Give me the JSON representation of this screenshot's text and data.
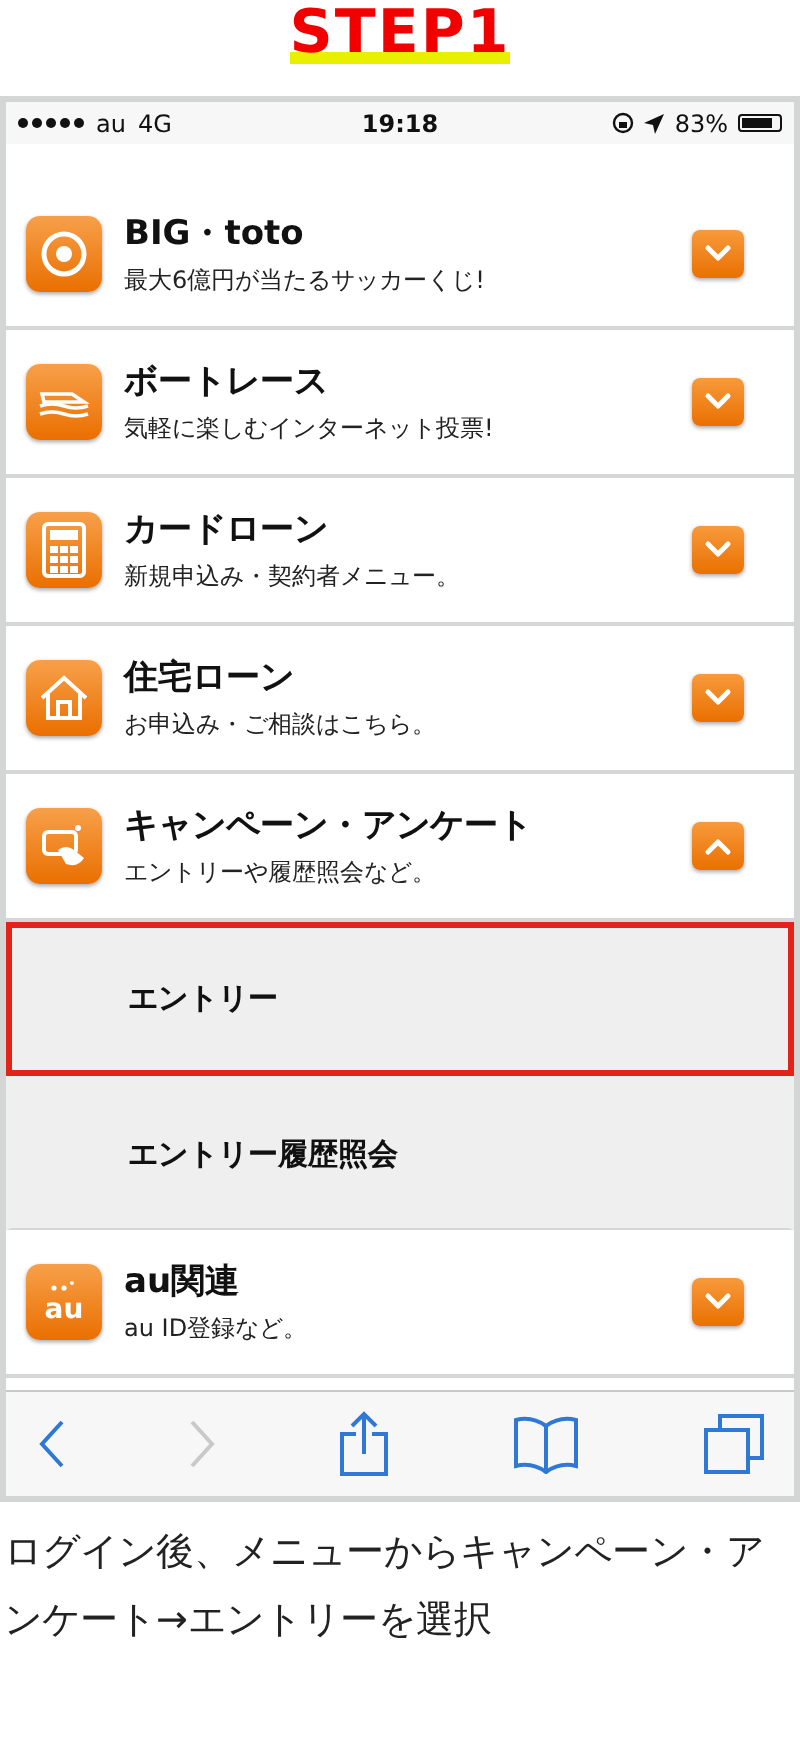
{
  "heading": "STEP1",
  "status_bar": {
    "carrier": "au",
    "network": "4G",
    "time": "19:18",
    "battery": "83%"
  },
  "menu": [
    {
      "kind": "item",
      "title": "BIG・toto",
      "subtitle": "最大6億円が当たるサッカーくじ!",
      "expanded": false
    },
    {
      "kind": "item",
      "title": "ボートレース",
      "subtitle": "気軽に楽しむインターネット投票!",
      "expanded": false
    },
    {
      "kind": "item",
      "title": "カードローン",
      "subtitle": "新規申込み・契約者メニュー。",
      "expanded": false
    },
    {
      "kind": "item",
      "title": "住宅ローン",
      "subtitle": "お申込み・ご相談はこちら。",
      "expanded": false
    },
    {
      "kind": "item",
      "title": "キャンペーン・アンケート",
      "subtitle": "エントリーや履歴照会など。",
      "expanded": true
    },
    {
      "kind": "subitem",
      "title": "エントリー",
      "highlighted": true
    },
    {
      "kind": "subitem",
      "title": "エントリー履歴照会",
      "highlighted": false
    },
    {
      "kind": "item",
      "icon_text": "au",
      "title": "au関連",
      "subtitle": "au ID登録など。",
      "expanded": false
    }
  ],
  "toolbar": [
    {
      "kind": "back",
      "disabled": false
    },
    {
      "kind": "forward",
      "disabled": true
    },
    {
      "kind": "share",
      "disabled": false
    },
    {
      "kind": "bookmarks",
      "disabled": false
    },
    {
      "kind": "tabs",
      "disabled": false
    }
  ],
  "caption": "ログイン後、メニューからキャンペーン・アンケート→エントリーを選択"
}
